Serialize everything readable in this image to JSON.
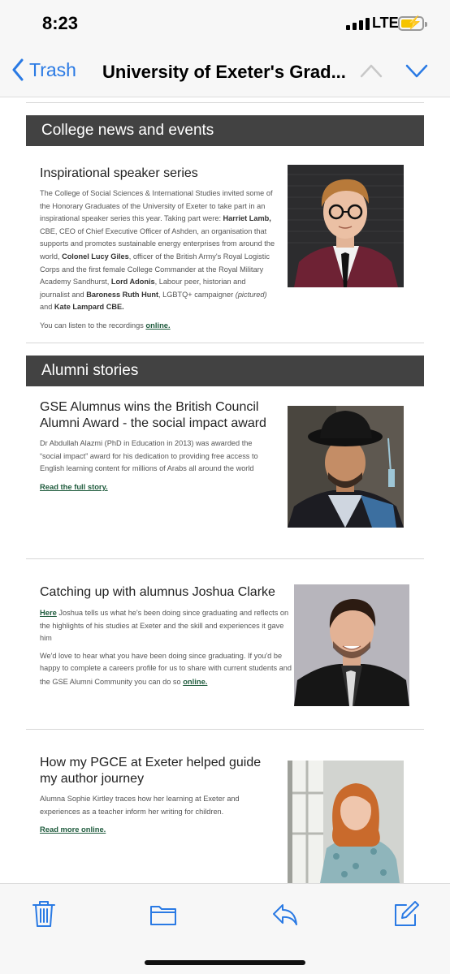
{
  "status": {
    "time": "8:23",
    "network": "LTE"
  },
  "nav": {
    "back_label": "Trash",
    "title": "University of Exeter's Grad..."
  },
  "sections": {
    "college": {
      "header": "College news and events"
    },
    "alumni": {
      "header": "Alumni stories"
    }
  },
  "articles": {
    "speaker": {
      "title": "Inspirational speaker series",
      "body_1": "The College of Social Sciences & International Studies invited some of the Honorary Graduates of the University of Exeter to take part in an inspirational speaker series this year.  Taking part were: ",
      "b1": "Harriet Lamb,",
      "body_2": " CBE, CEO of Chief Executive Officer of Ashden, an organisation that supports and promotes sustainable energy enterprises from around the world, ",
      "b2": "Colonel Lucy Giles",
      "body_3": ", officer of the British Army's Royal Logistic Corps and the first female College Commander at the Royal Military Academy Sandhurst,  ",
      "b3": "Lord Adonis",
      "body_4": ", Labour peer, historian and journalist and ",
      "b4": "Baroness Ruth Hunt",
      "body_5": ", LGBTQ+ campaigner ",
      "i1": "(pictured)",
      "body_6": " and ",
      "b5": "Kate Lampard CBE.",
      "listen_text": "You can listen to the recordings ",
      "listen_link": "online."
    },
    "award": {
      "title": "GSE Alumnus wins the British Council Alumni Award - the social impact award",
      "body": "Dr Abdullah Alazmi (PhD in Education in 2013) was awarded the “social impact” award for his dedication to providing free access to English learning content for millions of Arabs all around the world",
      "link": "Read the full story."
    },
    "joshua": {
      "title": "Catching up with alumnus Joshua Clarke",
      "here_link": "Here",
      "body_1": " Joshua tells us what he's been doing since graduating and reflects on the highlights of his studies at Exeter and the skill and experiences it gave him",
      "body_2": "We'd love to hear what you have been doing since graduating. If you'd be happy to complete a careers profile for us to share with current students and the GSE Alumni Community you can do so ",
      "online_link": "online."
    },
    "pgce": {
      "title": "How my PGCE at Exeter helped guide my author journey",
      "body": "Alumna Sophie Kirtley traces how her learning at Exeter and experiences as a teacher inform her writing for children.",
      "link": "Read more online."
    }
  },
  "toolbar": {
    "icons": [
      "trash-icon",
      "folder-icon",
      "reply-icon",
      "compose-icon"
    ]
  },
  "colors": {
    "accent": "#2a7ae4",
    "section_header_bg": "#424242",
    "link": "#1f5b3d",
    "battery": "#f5c400"
  }
}
